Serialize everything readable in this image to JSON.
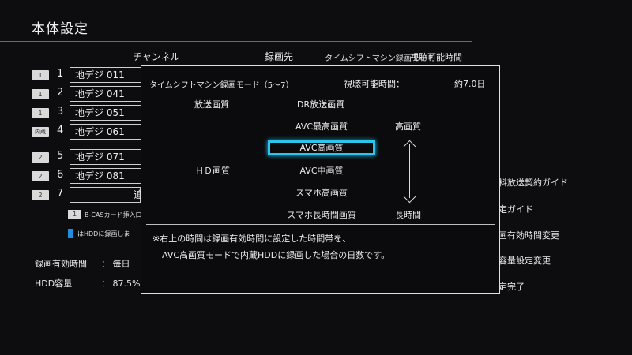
{
  "screen": {
    "title": "本体設定"
  },
  "columns": {
    "channel": "チャンネル",
    "destination": "録画先",
    "timeshift_mode": "タイムシフトマシン録画モード",
    "viewable_time": "視聴可能時間"
  },
  "channel_rows": [
    {
      "badge": "1",
      "num": "1",
      "channel": "地デジ 011"
    },
    {
      "badge": "1",
      "num": "2",
      "channel": "地デジ 041"
    },
    {
      "badge": "1",
      "num": "3",
      "channel": "地デジ 051"
    },
    {
      "badge": "内蔵",
      "num": "4",
      "channel": "地デジ 061"
    },
    {
      "badge": "2",
      "num": "5",
      "channel": "地デジ 071"
    },
    {
      "badge": "2",
      "num": "6",
      "channel": "地デジ 081"
    },
    {
      "badge": "2",
      "num": "7",
      "channel": "",
      "tail": "追"
    }
  ],
  "notes": {
    "bcas_badge": "1",
    "bcas_text": "B-CASカード挿入口",
    "hdd_text": "はHDDに録画しま"
  },
  "footer": {
    "rec_time_label": "録画有効時間",
    "rec_time_value": "： 毎日",
    "hdd_label": "HDD容量",
    "hdd_value": "： 87.5%"
  },
  "side_menu": [
    "料放送契約ガイド",
    "定ガイド",
    "画有効時間変更",
    "容量設定変更",
    "定完了"
  ],
  "dialog": {
    "title": "タイムシフトマシン録画モード（5〜7）",
    "viewable_label": "視聴可能時間：",
    "viewable_value": "約7.0日",
    "broadcast_quality": "放送画質",
    "dr_quality": "DR放送画質",
    "hd_quality": "ＨＤ画質",
    "options": [
      "AVC最高画質",
      "AVC高画質",
      "AVC中画質",
      "スマホ高画質",
      "スマホ長時間画質"
    ],
    "selected_index": 1,
    "high_quality": "高画質",
    "long_time": "長時間",
    "note_line1": "※右上の時間は録画有効時間に設定した時間帯を、",
    "note_line2": "AVC高画質モードで内蔵HDDに録画した場合の日数です。"
  },
  "colors": {
    "focus": "#29c6ee",
    "hdd_marker": "#1f8de0",
    "background": "#0d0d0f"
  }
}
